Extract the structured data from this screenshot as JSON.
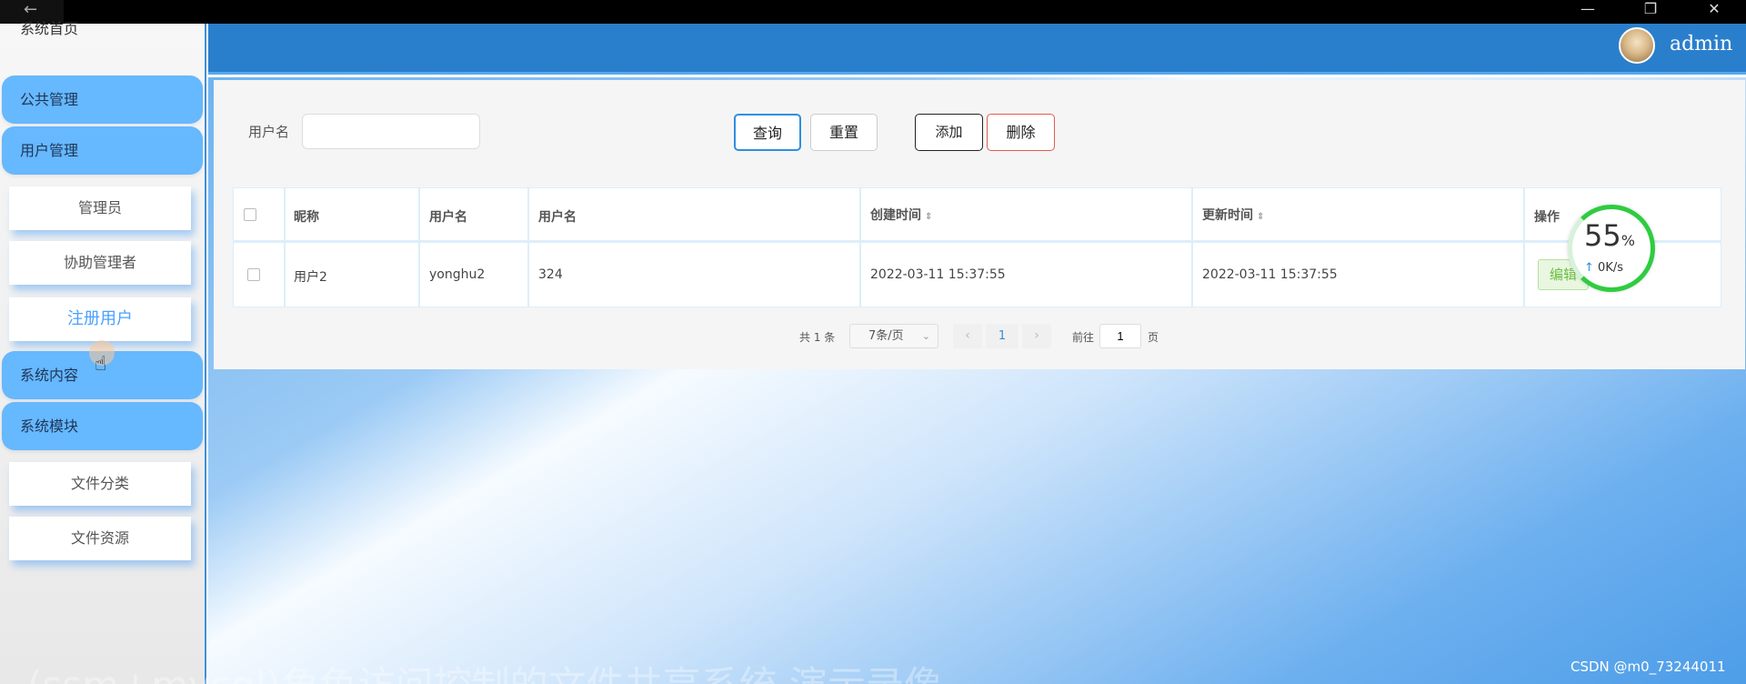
{
  "window": {
    "back_icon": "arrow-left-icon",
    "controls": [
      "minimize-icon",
      "restore-icon",
      "close-icon"
    ],
    "minimize_glyph": "—",
    "restore_glyph": "❐",
    "close_glyph": "✕"
  },
  "sidebar": {
    "home": "系统首页",
    "groups": [
      {
        "label": "公共管理"
      },
      {
        "label": "用户管理"
      },
      {
        "label": "系统内容"
      },
      {
        "label": "系统模块"
      }
    ],
    "user_items": [
      {
        "label": "管理员"
      },
      {
        "label": "协助管理者"
      },
      {
        "label": "注册用户",
        "active": true
      }
    ],
    "module_items": [
      {
        "label": "文件分类"
      },
      {
        "label": "文件资源"
      }
    ]
  },
  "header": {
    "username": "admin"
  },
  "search": {
    "label": "用户名",
    "value": "",
    "query_button": "查询",
    "reset_button": "重置",
    "add_button": "添加",
    "delete_button": "删除"
  },
  "table": {
    "headers": [
      "昵称",
      "用户名",
      "用户名",
      "创建时间",
      "更新时间",
      "操作"
    ],
    "rows": [
      {
        "nickname": "用户2",
        "username": "yonghu2",
        "username2": "324",
        "created": "2022-03-11 15:37:55",
        "updated": "2022-03-11 15:37:55",
        "action": "编辑"
      }
    ],
    "sort_glyph": "⇕"
  },
  "pagination": {
    "total": "共 1 条",
    "page_size": "7条/页",
    "current_page": "1",
    "goto_label": "前往",
    "goto_value": "1",
    "page_unit": "页",
    "prev": "‹",
    "next": "›",
    "caret": "⌄"
  },
  "speed_widget": {
    "percent": "55",
    "percent_sign": "%",
    "rate": "0K/s",
    "arrow": "↑"
  },
  "watermarks": {
    "bottom": "(ssm+mysql)角色访问控制的文件共享系统 演示录像",
    "csdn": "CSDN @m0_73244011"
  }
}
